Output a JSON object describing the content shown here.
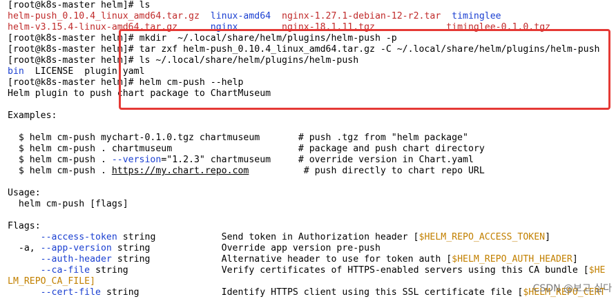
{
  "prompt": "[root@k8s-master helm]#",
  "lines": [
    {
      "cmd": "ls"
    },
    {
      "files1": [
        "helm-push_0.10.4_linux_amd64.tar.gz",
        "linux-amd64",
        "nginx-1.27.1-debian-12-r2.tar",
        "timinglee"
      ]
    },
    {
      "files2": [
        "helm-v3.15.4-linux-amd64.tar.gz",
        "nginx",
        "nginx-18.1.11.tgz",
        "timinglee-0.1.0.tgz"
      ]
    },
    {
      "cmd": "mkdir  ~/.local/share/helm/plugins/helm-push -p"
    },
    {
      "cmd": "tar zxf helm-push_0.10.4_linux_amd64.tar.gz -C ~/.local/share/helm/plugins/helm-push"
    },
    {
      "cmd": "ls ~/.local/share/helm/plugins/helm-push"
    },
    {
      "files3": [
        "bin",
        "LICENSE",
        "plugin.yaml"
      ]
    },
    {
      "cmd": "helm cm-push --help"
    },
    {
      "text": "Helm plugin to push chart package to ChartMuseum"
    }
  ],
  "examples_title": "Examples:",
  "examples": [
    {
      "cmd": "  $ helm cm-push mychart-0.1.0.tgz chartmuseum",
      "comment": "# push .tgz from \"helm package\""
    },
    {
      "cmd": "  $ helm cm-push . chartmuseum",
      "comment": "# package and push chart directory"
    },
    {
      "cmd_pre": "  $ helm cm-push . ",
      "cmd_flag": "--version",
      "cmd_post": "=\"1.2.3\" chartmuseum",
      "comment": "# override version in Chart.yaml"
    },
    {
      "cmd_pre": "  $ helm cm-push . ",
      "link": "https://my.chart.repo.com",
      "comment": "# push directly to chart repo URL"
    }
  ],
  "usage_title": "Usage:",
  "usage": "  helm cm-push [flags]",
  "flags_title": "Flags:",
  "flags": [
    {
      "short": "",
      "long": "--access-token",
      "type": "string",
      "desc": "Send token in Authorization header [",
      "env": "$HELM_REPO_ACCESS_TOKEN",
      "tail": "]"
    },
    {
      "short": "  -a, ",
      "long": "--app-version",
      "type": "string",
      "desc": "Override app version pre-push",
      "env": "",
      "tail": ""
    },
    {
      "short": "",
      "long": "--auth-header",
      "type": "string",
      "desc": "Alternative header to use for token auth [",
      "env": "$HELM_REPO_AUTH_HEADER",
      "tail": "]"
    },
    {
      "short": "",
      "long": "--ca-file",
      "type": "string",
      "desc": "Verify certificates of HTTPS-enabled servers using this CA bundle [",
      "env": "$HE",
      "tail": ""
    }
  ],
  "wrap_line": "LM_REPO_CA_FILE]",
  "partial_flag": {
    "long": "--cert-file",
    "type": "string",
    "desc": "Identify HTTPS client using this SSL certificate file [",
    "env": "$HELM_REPO_CERT"
  },
  "watermark": "CSDN @보고.싶다"
}
